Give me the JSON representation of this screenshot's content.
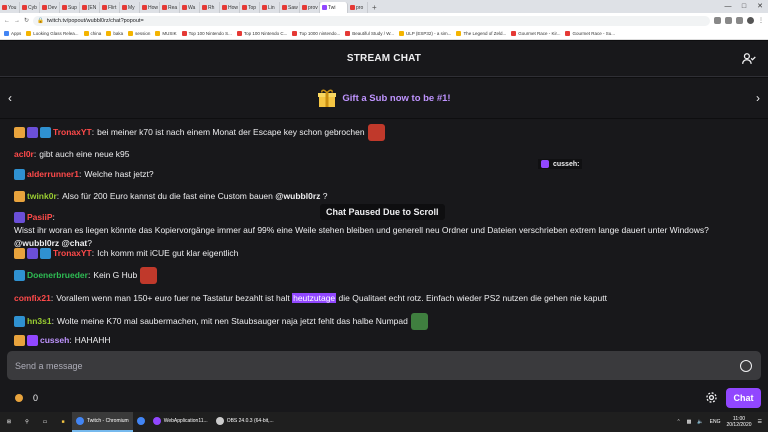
{
  "browser": {
    "tabs": [
      {
        "label": "You"
      },
      {
        "label": "Cyb"
      },
      {
        "label": "Dev"
      },
      {
        "label": "Sup"
      },
      {
        "label": "[EN"
      },
      {
        "label": "Flirt"
      },
      {
        "label": "My"
      },
      {
        "label": "How"
      },
      {
        "label": "Rea"
      },
      {
        "label": "Wa"
      },
      {
        "label": "Rh"
      },
      {
        "label": "How"
      },
      {
        "label": "Top"
      },
      {
        "label": "Lin"
      },
      {
        "label": "Saw"
      },
      {
        "label": "prov"
      },
      {
        "label": "Twi"
      },
      {
        "label": "pro"
      }
    ],
    "active_tab_index": 16,
    "new_tab_label": "+",
    "address": "twitch.tv/popout/wubbl0rz/chat?popout=",
    "bookmarks": [
      {
        "label": "Apps",
        "color": "blue"
      },
      {
        "label": "Looking Glass Relea...",
        "color": "yellow"
      },
      {
        "label": "china",
        "color": "yellow"
      },
      {
        "label": "baka",
        "color": "yellow"
      },
      {
        "label": "session",
        "color": "yellow"
      },
      {
        "label": "MUSIK",
        "color": "yellow"
      },
      {
        "label": "Top 100 Nintendo S...",
        "color": "red"
      },
      {
        "label": "Top 100 Nintendo C...",
        "color": "red"
      },
      {
        "label": "Top 1000 nintendo...",
        "color": "red"
      },
      {
        "label": "Beautiful Study / W...",
        "color": "red"
      },
      {
        "label": "ULP (ESP32) - a sim...",
        "color": "yellow"
      },
      {
        "label": "The Legend of Zeld...",
        "color": "yellow"
      },
      {
        "label": "Gourmet Race - Kir...",
        "color": "red"
      },
      {
        "label": "Gourmet Race - Su...",
        "color": "red"
      }
    ]
  },
  "header": {
    "title": "STREAM CHAT"
  },
  "promo": {
    "text": "Gift a Sub now to be #1!"
  },
  "chat": {
    "messages": [
      {
        "badges": [
          "prime",
          "sub",
          "crown"
        ],
        "user": "TronaxYT",
        "color": "#ff4a4a",
        "text": "bei meiner k70 ist nach einem Monat der Escape key schon gebrochen",
        "emote": "#c0392b"
      },
      {
        "badges": [],
        "user": "acl0r",
        "color": "#ff4a4a",
        "text": "gibt auch eine neue k95"
      },
      {
        "badges": [
          "crown"
        ],
        "user": "alderrunner1",
        "color": "#ff4a4a",
        "text": "Welche hast jetzt?"
      },
      {
        "badges": [
          "prime"
        ],
        "user": "twink0r",
        "color": "#9acd32",
        "text": "Also für 200 Euro kannst du die fast eine Custom bauen",
        "mention": "@wubbl0rz",
        "after": " ?"
      },
      {
        "badges": [
          "sub"
        ],
        "user": "PasiiP",
        "color": "#ff4a4a",
        "text": "Wisst ihr woran es liegen könnte das Kopiervorgänge immer auf 99% eine Weile stehen bleiben und generell neu Ordner und Dateien verschrieben extrem lange dauert unter Windows?",
        "mention": "@wubbl0rz @chat",
        "after": "?"
      },
      {
        "badges": [
          "prime",
          "sub",
          "crown"
        ],
        "user": "TronaxYT",
        "color": "#ff4a4a",
        "text": "Ich komm mit iCUE gut klar eigentlich"
      },
      {
        "badges": [
          "crown"
        ],
        "user": "Doenerbrueder",
        "color": "#2ebd54",
        "text": "Kein G Hub",
        "emote": "#c0392b"
      },
      {
        "badges": [],
        "user": "comfix21",
        "color": "#ff4a4a",
        "text_before": "Vorallem wenn man 150+ euro fuer ne Tastatur bezahlt ist halt ",
        "highlight": "heutzutage",
        "text_after": " die Qualitaet echt rotz. Einfach wieder PS2 nutzen die gehen nie kaputt"
      },
      {
        "badges": [
          "crown"
        ],
        "user": "hn3s1",
        "color": "#9acd32",
        "text": "Wolte meine K70 mal saubermachen, mit nen Staubsauger naja jetzt fehlt das halbe Numpad",
        "emote": "#3f7f3f"
      },
      {
        "badges": [
          "prime",
          "gift"
        ],
        "user": "cusseh",
        "color": "#bf94ff",
        "text": "HAHAHH"
      }
    ],
    "floating_user": "cusseh:",
    "paused_text": "Chat Paused Due to Scroll"
  },
  "input": {
    "placeholder": "Send a message"
  },
  "footer": {
    "points": "0",
    "chat_button": "Chat"
  },
  "taskbar": {
    "apps": [
      {
        "label": "Twitch - Chromium",
        "color": "#4285f4",
        "active": true
      },
      {
        "label": "",
        "color": "#4285f4",
        "active": false
      },
      {
        "label": "WebApplication11...",
        "color": "#9147ff",
        "active": false
      },
      {
        "label": "OBS 24.0.3 (64-bit,...",
        "color": "#cccccc",
        "active": false
      }
    ],
    "language": "ENG",
    "time": "11:00",
    "date": "20/12/2020"
  }
}
